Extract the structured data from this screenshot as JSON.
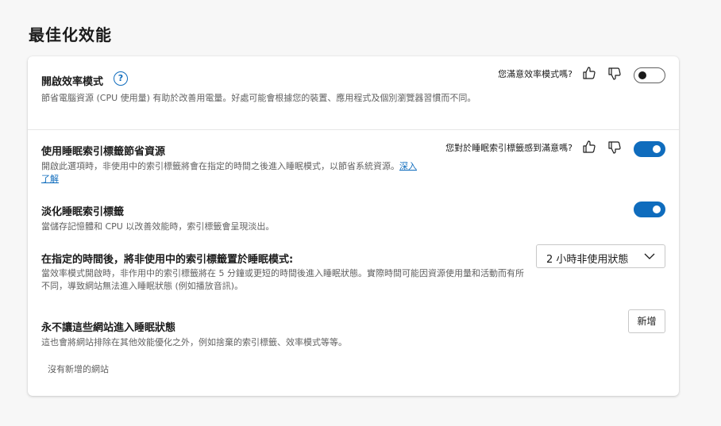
{
  "page": {
    "title": "最佳化效能"
  },
  "efficiency": {
    "heading": "開啟效率模式",
    "help_icon": "?",
    "description": "節省電腦資源 (CPU 使用量) 有助於改善用電量。好處可能會根據您的裝置、應用程式及個別瀏覽器習慣而不同。",
    "feedback_question": "您滿意效率模式嗎?",
    "toggle_state": "off"
  },
  "sleeping_tabs": {
    "heading": "使用睡眠索引標籤節省資源",
    "description": "開啟此選項時，非使用中的索引標籤將會在指定的時間之後進入睡眠模式，以節省系統資源。",
    "learn_more": "深入了解",
    "feedback_question": "您對於睡眠索引標籤感到滿意嗎?",
    "toggle_state": "on"
  },
  "fade_tabs": {
    "heading": "淡化睡眠索引標籤",
    "description": "當儲存記憶體和 CPU 以改善效能時，索引標籤會呈現淡出。",
    "toggle_state": "on"
  },
  "sleep_timer": {
    "heading": "在指定的時間後，將非使用中的索引標籤置於睡眠模式:",
    "description": "當效率模式開啟時，非作用中的索引標籤將在 5 分鐘或更短的時間後進入睡眠狀態。實際時間可能因資源使用量和活動而有所不同，導致網站無法進入睡眠狀態 (例如播放音訊)。",
    "selected_option": "2 小時非使用狀態"
  },
  "never_sleep": {
    "heading": "永不讓這些網站進入睡眠狀態",
    "description": "這也會將網站排除在其他效能優化之外，例如捨棄的索引標籤、效率模式等等。",
    "add_button": "新增",
    "empty_text": "沒有新增的網站"
  },
  "colors": {
    "accent": "#0f6cbd",
    "background": "#f7f7f7",
    "card": "#ffffff"
  },
  "icons": {
    "help": "question-circle-icon",
    "like": "thumbs-up-icon",
    "dislike": "thumbs-down-icon",
    "dropdown": "chevron-down-icon"
  }
}
